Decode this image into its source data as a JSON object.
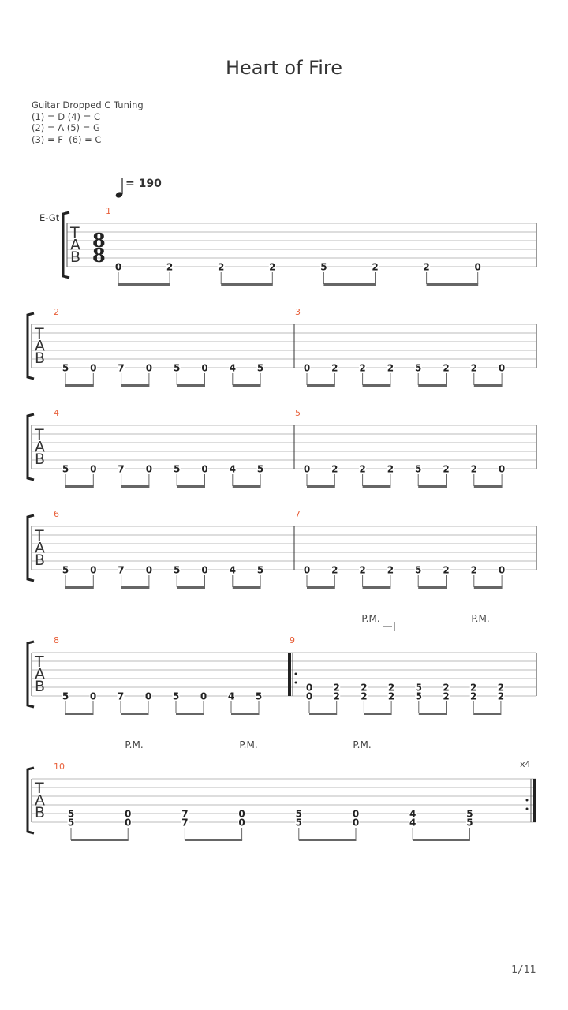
{
  "title": "Heart of Fire",
  "tuning": {
    "name": "Guitar Dropped C Tuning",
    "lines": [
      "(1) = D (4) = C",
      "(2) = A (5) = G",
      "(3) = F  (6) = C"
    ]
  },
  "tempo": {
    "note": "quarter",
    "bpm": "= 190"
  },
  "instrument": "E-Gt",
  "time_signature": "8/8",
  "tab_letters": [
    "T",
    "A",
    "B"
  ],
  "repeat_count": "x4",
  "palm_mute_label": "P.M.",
  "page": "1/11",
  "colors": {
    "bar_number": "#e8603a",
    "staff_line": "#bbbbbb",
    "text": "#333333"
  },
  "systems": [
    {
      "bars": [
        {
          "number": "1",
          "strings": [
            6
          ],
          "notes": [
            "0",
            "2",
            "2",
            "2",
            "5",
            "2",
            "2",
            "0"
          ]
        }
      ],
      "first": true
    },
    {
      "bars": [
        {
          "number": "2",
          "strings": [
            6
          ],
          "notes": [
            "5",
            "0",
            "7",
            "0",
            "5",
            "0",
            "4",
            "5"
          ]
        },
        {
          "number": "3",
          "strings": [
            6
          ],
          "notes": [
            "0",
            "2",
            "2",
            "2",
            "5",
            "2",
            "2",
            "0"
          ]
        }
      ]
    },
    {
      "bars": [
        {
          "number": "4",
          "strings": [
            6
          ],
          "notes": [
            "5",
            "0",
            "7",
            "0",
            "5",
            "0",
            "4",
            "5"
          ]
        },
        {
          "number": "5",
          "strings": [
            6
          ],
          "notes": [
            "0",
            "2",
            "2",
            "2",
            "5",
            "2",
            "2",
            "0"
          ]
        }
      ]
    },
    {
      "bars": [
        {
          "number": "6",
          "strings": [
            6
          ],
          "notes": [
            "5",
            "0",
            "7",
            "0",
            "5",
            "0",
            "4",
            "5"
          ]
        },
        {
          "number": "7",
          "strings": [
            6
          ],
          "notes": [
            "0",
            "2",
            "2",
            "2",
            "5",
            "2",
            "2",
            "0"
          ]
        }
      ]
    },
    {
      "bars": [
        {
          "number": "8",
          "strings": [
            6
          ],
          "notes": [
            "5",
            "0",
            "7",
            "0",
            "5",
            "0",
            "4",
            "5"
          ]
        },
        {
          "number": "9",
          "strings": [
            5,
            6
          ],
          "notes": [
            "0",
            "2",
            "2",
            "2",
            "5",
            "2",
            "2",
            "2"
          ],
          "repeat_start": true,
          "pm": [
            "P.M.",
            "P.M."
          ]
        }
      ]
    },
    {
      "bars": [
        {
          "number": "10",
          "strings": [
            5,
            6
          ],
          "notes": [
            "5",
            "0",
            "7",
            "0",
            "5",
            "0",
            "4",
            "5"
          ],
          "repeat_end": true,
          "pm": [
            "P.M.",
            "P.M.",
            "P.M."
          ]
        }
      ]
    }
  ]
}
